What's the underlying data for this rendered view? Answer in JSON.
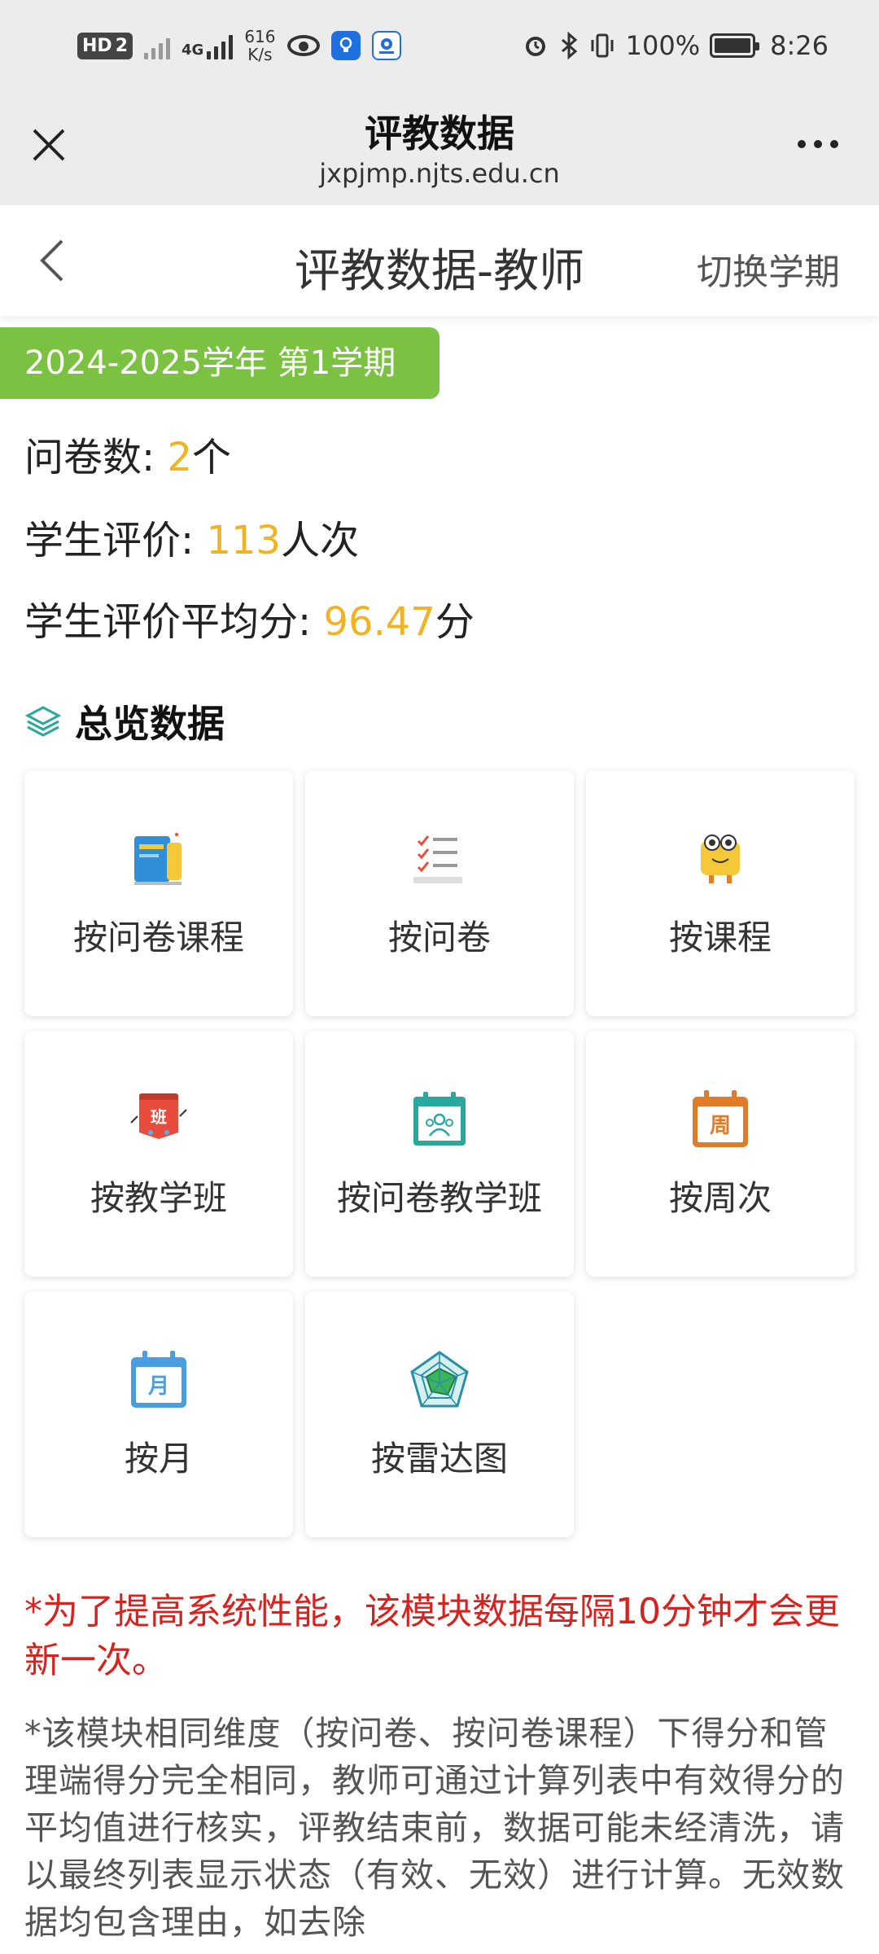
{
  "status_bar": {
    "hd_badge": "HD",
    "sim_badge": "2",
    "net_label": "4G",
    "speed_value": "616",
    "speed_unit": "K/s",
    "battery_text": "100%",
    "time": "8:26"
  },
  "browser": {
    "title": "评教数据",
    "url": "jxpjmp.njts.edu.cn"
  },
  "page": {
    "title": "评教数据-教师",
    "switch_term_label": "切换学期"
  },
  "term": "2024-2025学年 第1学期",
  "stats": {
    "questionnaires": {
      "label": "问卷数: ",
      "value": "2",
      "unit": "个"
    },
    "student_evals": {
      "label": "学生评价: ",
      "value": "113",
      "unit": "人次"
    },
    "avg_score": {
      "label": "学生评价平均分: ",
      "value": "96.47",
      "unit": "分"
    }
  },
  "overview": {
    "title": "总览数据",
    "items": [
      {
        "label": "按问卷课程",
        "icon": "book-icon"
      },
      {
        "label": "按问卷",
        "icon": "checklist-icon"
      },
      {
        "label": "按课程",
        "icon": "mascot-icon"
      },
      {
        "label": "按教学班",
        "icon": "class-badge-icon"
      },
      {
        "label": "按问卷教学班",
        "icon": "group-calendar-icon"
      },
      {
        "label": "按周次",
        "icon": "week-calendar-icon"
      },
      {
        "label": "按月",
        "icon": "month-calendar-icon"
      },
      {
        "label": "按雷达图",
        "icon": "radar-chart-icon"
      }
    ]
  },
  "notes": {
    "red": "*为了提高系统性能，该模块数据每隔10分钟才会更新一次。",
    "gray": "*该模块相同维度（按问卷、按问卷课程）下得分和管理端得分完全相同，教师可通过计算列表中有效得分的平均值进行核实，评教结束前，数据可能未经清洗，请以最终列表显示状态（有效、无效）进行计算。无效数据均包含理由，如去除"
  },
  "colors": {
    "accent_green": "#7cc242",
    "number_orange": "#f0b324",
    "note_red": "#d6231f"
  },
  "icons": {
    "close": "close-icon",
    "more": "more-icon",
    "back": "back-arrow-icon",
    "section": "layers-icon"
  }
}
